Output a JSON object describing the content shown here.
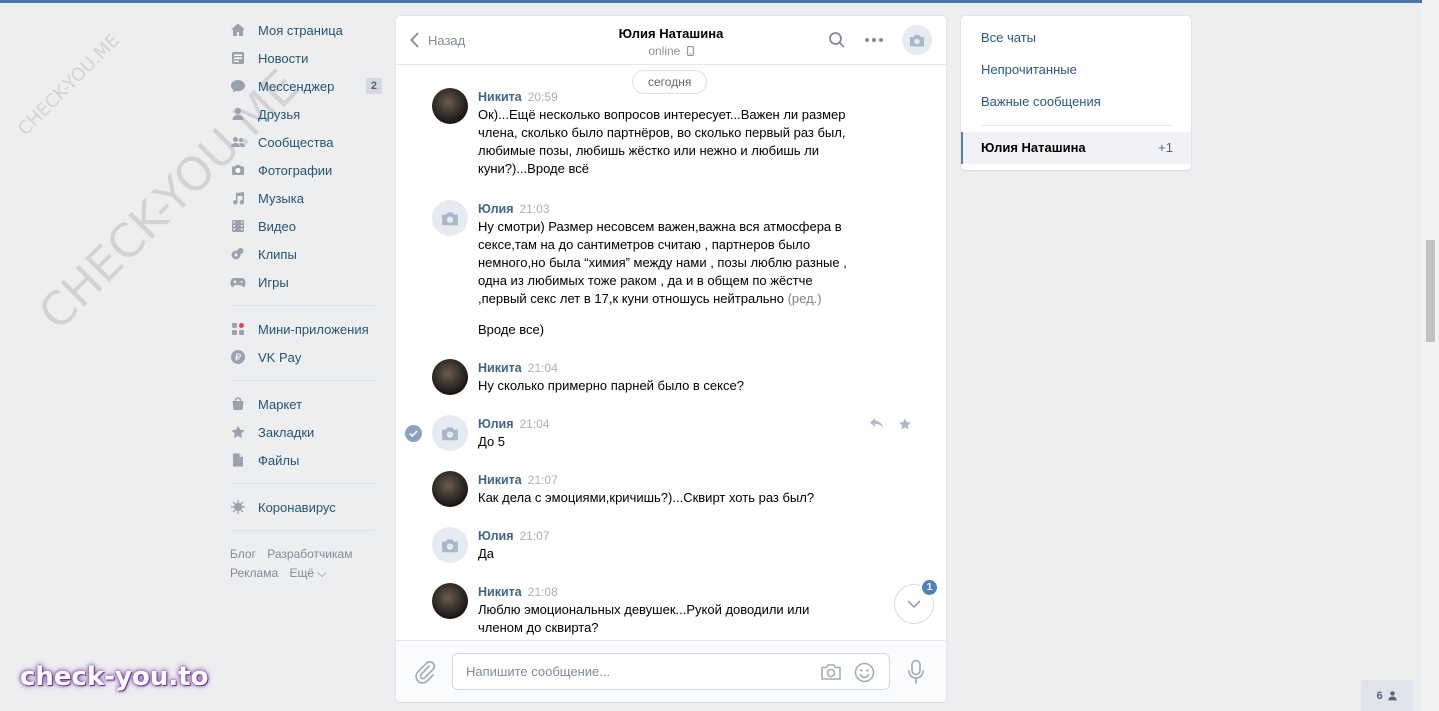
{
  "colors": {
    "accent": "#4a76a8",
    "link": "#2a5885",
    "author": "#42648b",
    "background": "#edeef0"
  },
  "watermarks": {
    "small": "CHECK-YOU.ME",
    "large": "CHECK-YOU.ME",
    "logo": "check-you.to"
  },
  "leftnav": {
    "group1": [
      {
        "label": "Моя страница",
        "icon": "home-icon"
      },
      {
        "label": "Новости",
        "icon": "news-icon"
      },
      {
        "label": "Мессенджер",
        "icon": "messenger-icon",
        "count": "2"
      },
      {
        "label": "Друзья",
        "icon": "friends-icon"
      },
      {
        "label": "Сообщества",
        "icon": "communities-icon"
      },
      {
        "label": "Фотографии",
        "icon": "photo-icon"
      },
      {
        "label": "Музыка",
        "icon": "music-icon"
      },
      {
        "label": "Видео",
        "icon": "video-icon"
      },
      {
        "label": "Клипы",
        "icon": "clips-icon"
      },
      {
        "label": "Игры",
        "icon": "games-icon"
      }
    ],
    "group2": [
      {
        "label": "Мини-приложения",
        "icon": "mini-apps-icon"
      },
      {
        "label": "VK Pay",
        "icon": "vkpay-icon"
      }
    ],
    "group3": [
      {
        "label": "Маркет",
        "icon": "market-icon"
      },
      {
        "label": "Закладки",
        "icon": "bookmarks-icon"
      },
      {
        "label": "Файлы",
        "icon": "files-icon"
      }
    ],
    "group4": [
      {
        "label": "Коронавирус",
        "icon": "coronavirus-icon"
      }
    ],
    "footer": {
      "blog": "Блог",
      "developers": "Разработчикам",
      "ads": "Реклама",
      "more": "Ещё ⌵"
    }
  },
  "chat": {
    "back_label": "Назад",
    "peer_name": "Юлия Наташина",
    "peer_status": "online",
    "date_label": "сегодня",
    "composer_placeholder": "Напишите сообщение...",
    "unread_badge": "1",
    "messages": [
      {
        "author": "Никита",
        "time": "20:59",
        "avatar": "photo",
        "text": "Ок)...Ещё несколько вопросов интересует...Важен ли размер\nчлена, сколько было партнёров, во сколько первый раз был,\nлюбимые позы, любишь жёстко или нежно и любишь ли\nкуни?)...Вроде всё"
      },
      {
        "author": "Юлия",
        "time": "21:03",
        "avatar": "camera",
        "text": "Ну смотри) Размер несовсем важен,важна вся атмосфера в\nсексе,там на до сантиметров считаю , партнеров было\nнемного,но была “химия” между нами , позы люблю разные ,\nодна из любимых тоже раком , да и в общем по жёстче\n,первый секс лет в 17,к куни отношусь нейтрально",
        "edited": "(ред.)",
        "extra": "Вроде все)"
      },
      {
        "author": "Никита",
        "time": "21:04",
        "avatar": "photo",
        "text": "Ну сколько примерно парней было в сексе?"
      },
      {
        "author": "Юлия",
        "time": "21:04",
        "avatar": "camera",
        "text": "До 5"
      },
      {
        "author": "Никита",
        "time": "21:07",
        "avatar": "photo",
        "text": "Как дела с эмоциями,кричишь?)...Сквирт хоть раз был?"
      },
      {
        "author": "Юлия",
        "time": "21:07",
        "avatar": "camera",
        "text": "Да"
      },
      {
        "author": "Никита",
        "time": "21:08",
        "avatar": "photo",
        "text": "Люблю эмоциональных девушек...Рукой доводили или\nчленом до сквирта?"
      }
    ]
  },
  "rightpanel": {
    "all_chats": "Все чаты",
    "unread": "Непрочитанные",
    "important": "Важные сообщения",
    "active_chat": "Юлия Наташина",
    "active_count": "+1"
  },
  "online_count": "6"
}
